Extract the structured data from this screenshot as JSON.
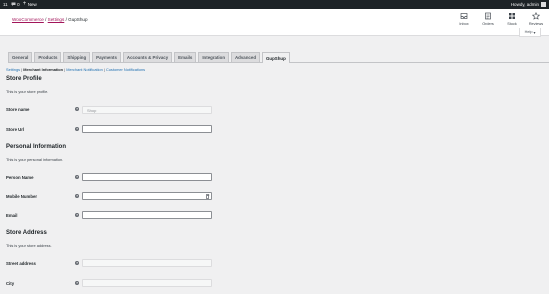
{
  "adminbar": {
    "updates": "11",
    "comments": "0",
    "new": "New",
    "greeting": "Howdy, admin"
  },
  "breadcrumb": {
    "woocommerce": "WooCommerce",
    "settings": "Settings",
    "current": "GupShup"
  },
  "toolbar": [
    {
      "label": "Inbox",
      "icon": "inbox-icon"
    },
    {
      "label": "Orders",
      "icon": "orders-icon"
    },
    {
      "label": "Stock",
      "icon": "stock-icon"
    },
    {
      "label": "Reviews",
      "icon": "star-icon"
    }
  ],
  "help": {
    "label": "Help"
  },
  "tabs": [
    "General",
    "Products",
    "Shipping",
    "Payments",
    "Accounts & Privacy",
    "Emails",
    "Integration",
    "Advanced",
    "GupShup"
  ],
  "active_tab": "GupShup",
  "subnav": {
    "settings": "Settings",
    "merchant_info": "Merchant Information",
    "merchant_notif": "Merchant Notification",
    "customer_notif": "Customer Notifications"
  },
  "store_profile": {
    "title": "Store Profile",
    "desc": "This is your store profile.",
    "store_name_label": "Store name",
    "store_name_value": "Shop",
    "store_url_label": "Store Url",
    "store_url_value": ""
  },
  "personal": {
    "title": "Personal Information",
    "desc": "This is your personal information.",
    "person_name_label": "Person Name",
    "mobile_label": "Mobile Number",
    "email_label": "Email"
  },
  "address": {
    "title": "Store Address",
    "desc": "This is your store address.",
    "street_label": "Street address",
    "city_label": "City"
  },
  "help_glyph": "?"
}
